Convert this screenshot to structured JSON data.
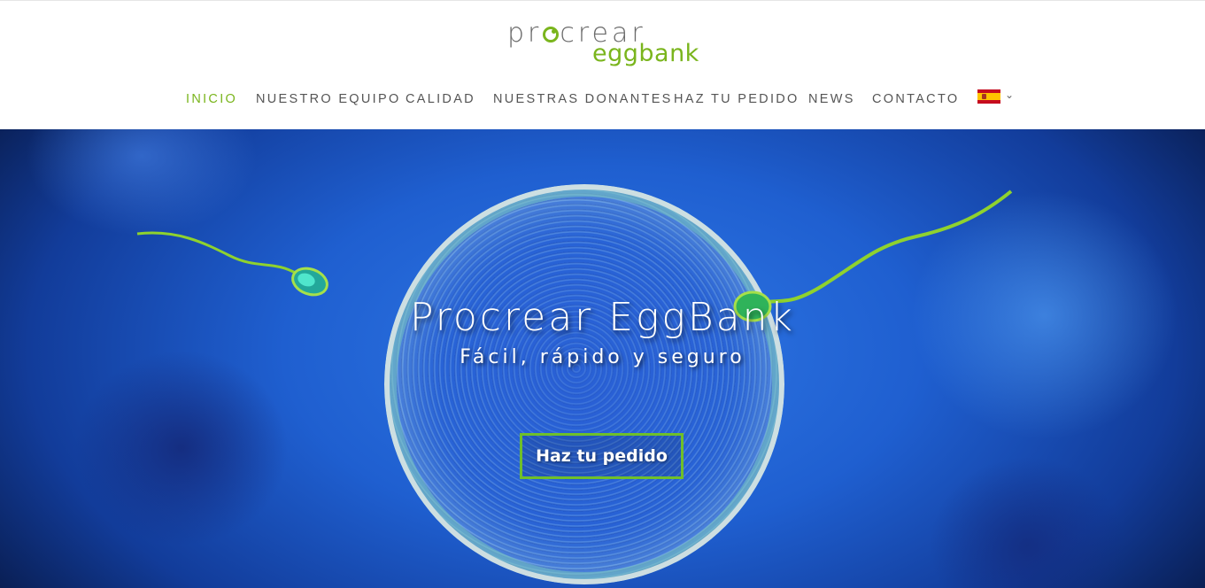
{
  "logo": {
    "top_text_1": "pr",
    "top_text_2": "crear",
    "bottom_text": "eggbank"
  },
  "nav": {
    "items": [
      {
        "label": "INICIO",
        "active": true
      },
      {
        "label": "NUESTRO EQUIPO"
      },
      {
        "label": "CALIDAD"
      },
      {
        "label": "NUESTRAS DONANTES"
      },
      {
        "label": "HAZ TU PEDIDO"
      },
      {
        "label": "NEWS"
      },
      {
        "label": "CONTACTO"
      }
    ],
    "language_icon": "spain-flag-icon",
    "dropdown_icon": "chevron-down-icon",
    "dropdown_glyph": "⌄"
  },
  "hero": {
    "title": "Procrear EggBank",
    "subtitle": "Fácil, rápido y seguro",
    "cta_label": "Haz tu pedido"
  },
  "colors": {
    "accent": "#7ab51d",
    "nav_text": "#555555",
    "hero_blue": "#1f5fd0"
  }
}
